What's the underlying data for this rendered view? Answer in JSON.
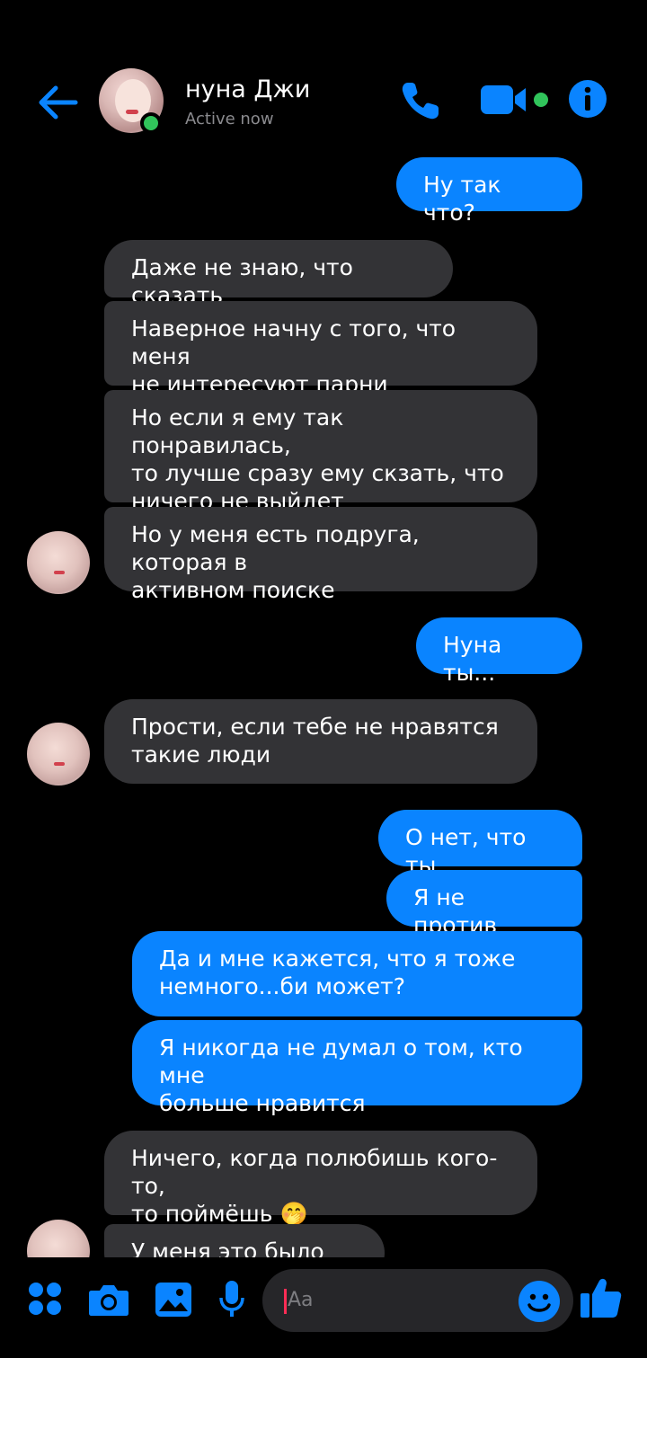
{
  "header": {
    "contact_name": "нуна Джи",
    "status": "Active now",
    "back_icon": "arrow-left-icon",
    "call_icon": "phone-icon",
    "video_icon": "video-camera-icon",
    "info_icon": "info-icon",
    "accent": "#0a84ff",
    "online_color": "#31c45b"
  },
  "messages": [
    {
      "from": "me",
      "text": "Ну так что?"
    },
    {
      "from": "them",
      "text": "Даже не знаю, что сказать"
    },
    {
      "from": "them",
      "text": "Наверное начну с того, что меня\nне интересуют парни"
    },
    {
      "from": "them",
      "text": "Но если я ему так понравилась,\nто лучше сразу ему скзать, что\nничего не выйдет"
    },
    {
      "from": "them",
      "text": "Но у меня есть подруга, которая в\nактивном поиске"
    },
    {
      "from": "me",
      "text": "Нуна ты..."
    },
    {
      "from": "them",
      "text": "Прости, если тебе не нравятся\nтакие люди"
    },
    {
      "from": "me",
      "text": "О нет, что ты"
    },
    {
      "from": "me",
      "text": "Я не против"
    },
    {
      "from": "me",
      "text": "Да и мне кажется, что я тоже\nнемного...би может?"
    },
    {
      "from": "me",
      "text": "Я никогда не думал о том, кто мне\nбольше нравится"
    },
    {
      "from": "them",
      "text": "Ничего, когда полюбишь кого-то,\nто поймёшь 🤭"
    },
    {
      "from": "them",
      "text": "У меня это было так"
    }
  ],
  "composer": {
    "placeholder": "Aa",
    "menu_icon": "four-dots-menu-icon",
    "camera_icon": "camera-icon",
    "gallery_icon": "image-gallery-icon",
    "mic_icon": "microphone-icon",
    "emoji_icon": "smiley-icon",
    "like_icon": "thumbs-up-icon"
  }
}
